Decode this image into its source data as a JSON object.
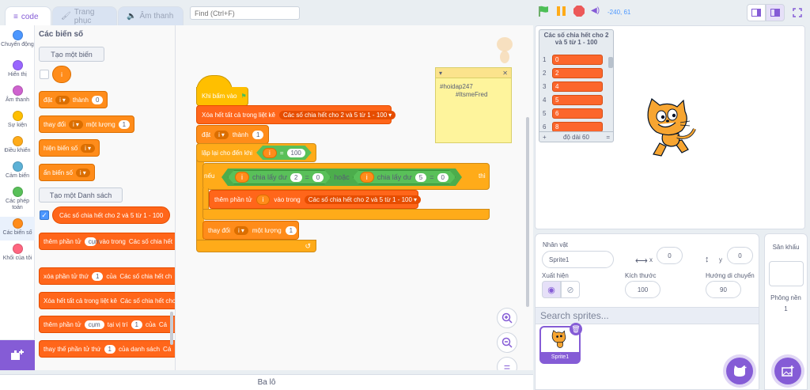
{
  "tabs": [
    {
      "label": "code",
      "icon": "code-icon"
    },
    {
      "label": "Trang phục",
      "icon": "costume-icon"
    },
    {
      "label": "Âm thanh",
      "icon": "sound-icon"
    }
  ],
  "find": {
    "placeholder": "Find (Ctrl+F)"
  },
  "categories": [
    {
      "label": "Chuyển động",
      "color": "#4c97ff"
    },
    {
      "label": "Hiển thị",
      "color": "#9966ff"
    },
    {
      "label": "Âm thanh",
      "color": "#cf63cf"
    },
    {
      "label": "Sự kiện",
      "color": "#ffbf00"
    },
    {
      "label": "Điều khiển",
      "color": "#ffab19"
    },
    {
      "label": "Cảm biến",
      "color": "#5cb1d6"
    },
    {
      "label": "Các phép toán",
      "color": "#59c059"
    },
    {
      "label": "Các biến số",
      "color": "#ff8c1a"
    },
    {
      "label": "Khối của tôi",
      "color": "#ff6680"
    }
  ],
  "palette": {
    "title": "Các biến số",
    "make_variable": "Tạo một biến",
    "variable_name": "i",
    "set_block": {
      "label": "đặt",
      "var": "i",
      "to": "thành",
      "value": "0"
    },
    "change_block": {
      "label": "thay đổi",
      "var": "i",
      "by": "một lượng",
      "value": "1"
    },
    "show_var": {
      "label": "hiện biến số",
      "var": "i"
    },
    "hide_var": {
      "label": "ẩn biến số",
      "var": "i"
    },
    "make_list": "Tạo một Danh sách",
    "list_name": "Các số chia hết cho 2 và 5 từ 1 - 100",
    "add_to": {
      "label": "thêm phần tử",
      "item": "cụm",
      "into": "vào trong",
      "list": "Các số chia hết"
    },
    "delete_of": {
      "label": "xóa phần tử thứ",
      "index": "1",
      "of": "của",
      "list": "Các số chia hết ch"
    },
    "delete_all": {
      "label": "Xóa hết tất cả trong liệt kê",
      "list": "Các số chia hết cho"
    },
    "insert_at": {
      "label": "thêm phần tử",
      "item": "cụm",
      "at": "tại vị trí",
      "index": "1",
      "of": "của",
      "list": "Cá"
    },
    "replace": {
      "label": "thay thế phần tử thứ",
      "index": "1",
      "of": "của danh sách",
      "list": "Cá"
    }
  },
  "script": {
    "hat": "Khi bấm vào",
    "clear": {
      "label": "Xóa hết tất cả trong liệt kê",
      "list": "Các số chia hết cho 2 và 5 từ 1 - 100"
    },
    "set": {
      "label": "đặt",
      "var": "i",
      "to": "thành",
      "value": "1"
    },
    "repeat_until": {
      "label": "lặp lại cho đến khi",
      "var": "i",
      "eq": "=",
      "value": "100"
    },
    "if": {
      "label": "nếu",
      "mod1": {
        "var": "i",
        "op": "chia lấy dư",
        "n": "2",
        "eq": "=",
        "r": "0"
      },
      "or": "hoặc",
      "mod2": {
        "var": "i",
        "op": "chia lấy dư",
        "n": "5",
        "eq": "=",
        "r": "0"
      },
      "then": "thì"
    },
    "add": {
      "label": "thêm phần tử",
      "var": "i",
      "into": "vào trong",
      "list": "Các số chia hết cho 2 và 5 từ 1 - 100"
    },
    "change": {
      "label": "thay đổi",
      "var": "i",
      "by": "một lượng",
      "value": "1"
    }
  },
  "note": {
    "line1": "#hoidap247",
    "line2": "#ItsmeFred"
  },
  "stage": {
    "coords": "-240, 61",
    "monitor": {
      "title": "Các số chia hết cho 2 và 5 từ 1 - 100",
      "rows": [
        {
          "index": "1",
          "value": "0"
        },
        {
          "index": "2",
          "value": "2"
        },
        {
          "index": "3",
          "value": "4"
        },
        {
          "index": "4",
          "value": "5"
        },
        {
          "index": "5",
          "value": "6"
        },
        {
          "index": "6",
          "value": "8"
        }
      ],
      "plus": "+",
      "length": "độ dài 60",
      "equals": "="
    }
  },
  "sprite_info": {
    "sprite_label": "Nhân vật",
    "sprite_name": "Sprite1",
    "x_label": "x",
    "x": "0",
    "y_label": "y",
    "y": "0",
    "show_label": "Xuất hiện",
    "size_label": "Kích thước",
    "size": "100",
    "direction_label": "Hướng di chuyển",
    "direction": "90",
    "search_placeholder": "Search sprites...",
    "thumb_name": "Sprite1"
  },
  "stage_panel": {
    "label": "Sân khấu",
    "backdrops_label": "Phông nền",
    "backdrops_count": "1"
  },
  "backpack": "Ba lô",
  "colors": {
    "accent": "#855cd6",
    "variables": "#ff8c1a",
    "lists": "#ff661a",
    "control": "#ffab19",
    "operators": "#59c059",
    "events": "#ffbf00"
  }
}
